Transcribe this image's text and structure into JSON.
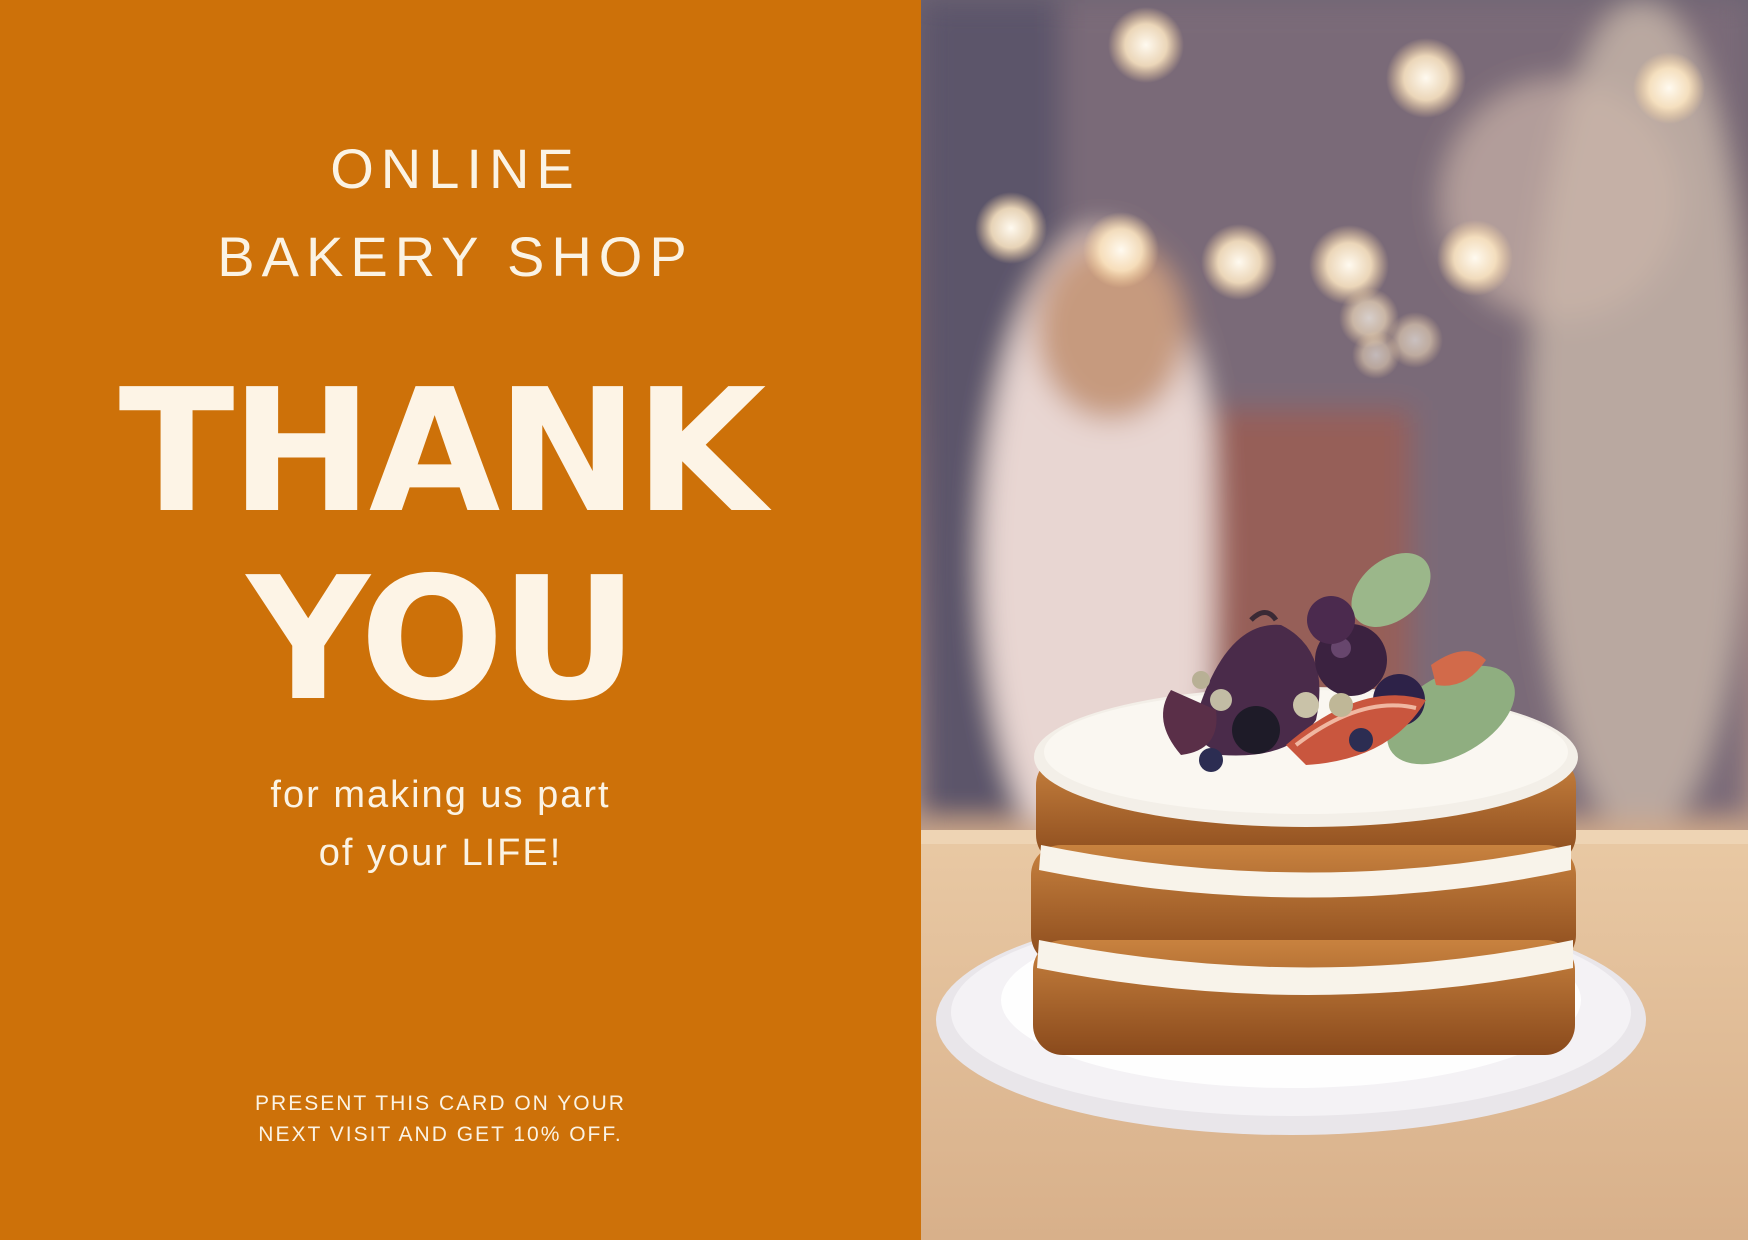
{
  "card": {
    "shop_name_line1": "ONLINE",
    "shop_name_line2": "BAKERY SHOP",
    "headline_line1": "THANK",
    "headline_line2": "YOU",
    "subline_line1": "for making us part",
    "subline_line2": "of your LIFE!",
    "offer_line1": "PRESENT THIS CARD ON YOUR",
    "offer_line2": "NEXT VISIT AND GET 10% OFF."
  },
  "colors": {
    "panel_background": "#cd7109",
    "text_cream": "#fbf3e4"
  },
  "photo": {
    "subject": "layered naked cake topped with figs and berries on a white plate, bokeh string lights background"
  }
}
